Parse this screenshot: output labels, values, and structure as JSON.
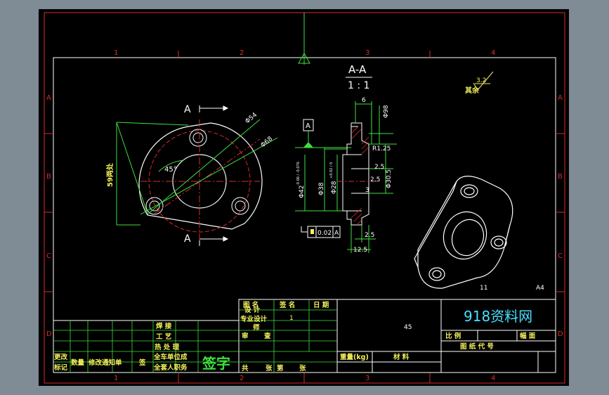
{
  "colors": {
    "background": "#000000",
    "border": "#d62b2b",
    "cyan": "#49e0ff",
    "green": "#3ee03e",
    "yellow": "#f4f15a",
    "white": "#ffffff",
    "frame_bg": "#7f8b95"
  },
  "zones": {
    "columns": [
      "1",
      "2",
      "3",
      "4"
    ],
    "rows": [
      "A",
      "B",
      "C",
      "D"
    ]
  },
  "section": {
    "label": "A-A",
    "scale": "1 : 1"
  },
  "roughness": {
    "value": "3.2",
    "rest": "其余"
  },
  "front_view": {
    "cut_label_top": "A",
    "cut_label_bottom": "A",
    "dim_phi54": "Φ54",
    "dim_phi68": "Φ68",
    "angle": "45°",
    "dim_59": "59两处"
  },
  "section_view": {
    "datum": "A",
    "dim_6": "6",
    "dim_phi98": "Φ98",
    "dim_r125": "R1.25",
    "dim_25a": "2.5",
    "dim_25b": "2.5",
    "dim_3": "3",
    "dim_phi305": "Φ30.5",
    "dim_phi42": "Φ42",
    "tol_phi42": "-0.06 / -0.076",
    "dim_phi38": "Φ38",
    "dim_phi28": "Φ28",
    "tol_phi28": "+0.02 / 0",
    "dim_25c": "2.5",
    "dim_125": "12.5",
    "gtol_value": "0.02",
    "gtol_datum": "A"
  },
  "iso_view": {
    "label_11": "11",
    "sheet": "A4"
  },
  "title_block": {
    "brand": "918资料网",
    "col_tuming": "图 名",
    "col_qianming": "签 名",
    "col_riqi": "日 期",
    "sheji": "设 计",
    "zhuanye": "专业设计",
    "zhuanye_val": "1",
    "shi": "师",
    "shenhe": "审",
    "cha": "查",
    "hanjie": "焊    接",
    "gongyi": "工    艺",
    "rechuli": "热  处  理",
    "chanpin": "全车单位成",
    "chanpin2": "全套人职务",
    "gaiban": "更改",
    "biaoji": "标记",
    "shuliang": "数量",
    "xiugai": "修改通知单",
    "qian": "签",
    "sign_big": "签字",
    "gong": "共",
    "zhang": "张",
    "di": "第",
    "zhang2": "张",
    "weight": "重量(kg)",
    "material": "材    料",
    "value_45": "45",
    "bili": "比 例",
    "fumian": "幅 面",
    "tuzhi": "图    纸    代    号"
  }
}
